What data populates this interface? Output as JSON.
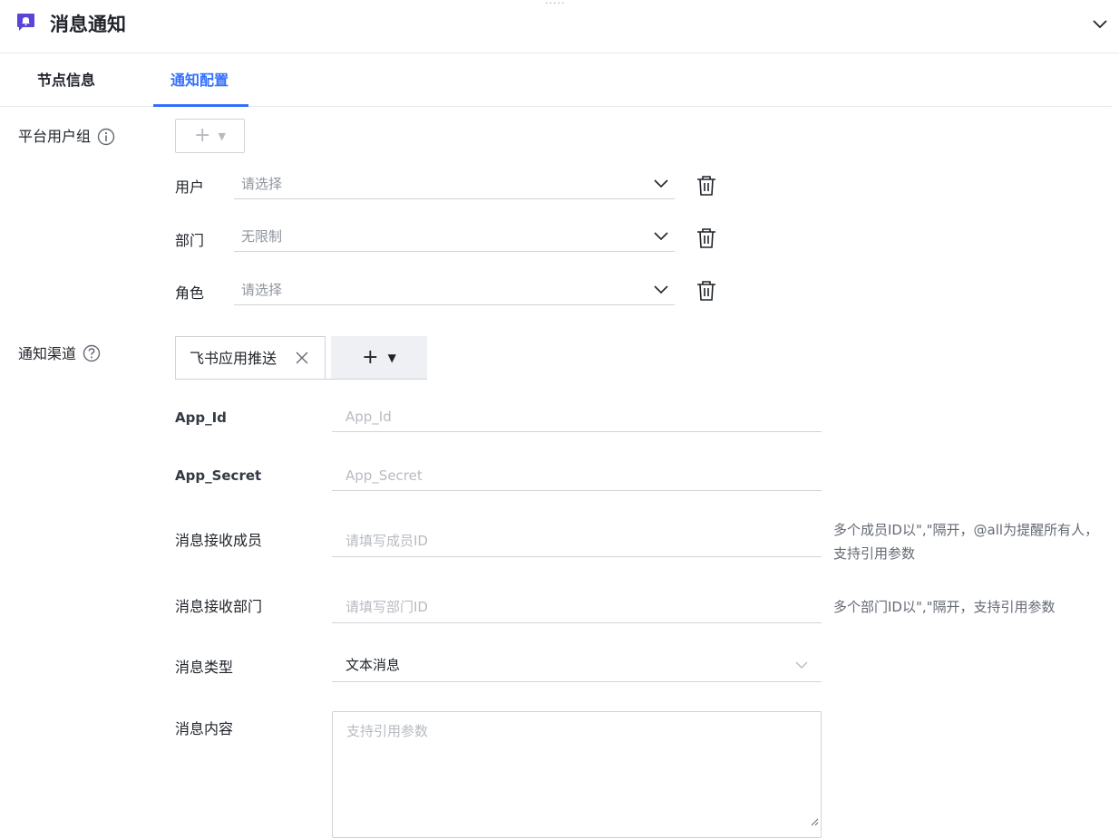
{
  "header": {
    "title": "消息通知",
    "icon": "bell-message-icon",
    "accent": "#5b45d9",
    "drag_handle": "....."
  },
  "tabs": [
    {
      "label": "节点信息",
      "active": false
    },
    {
      "label": "通知配置",
      "active": true
    }
  ],
  "colors": {
    "active_tab": "#3370ff",
    "border": "#d0d3d6",
    "text": "#1f2329",
    "hint": "#646a73",
    "placeholder": "#b7bbc1"
  },
  "platform_group": {
    "label": "平台用户组",
    "rows": [
      {
        "label": "用户",
        "placeholder": "请选择"
      },
      {
        "label": "部门",
        "placeholder": "无限制"
      },
      {
        "label": "角色",
        "placeholder": "请选择"
      }
    ]
  },
  "channel": {
    "label": "通知渠道",
    "active_channel": "飞书应用推送",
    "fields": {
      "app_id": {
        "label": "App_Id",
        "placeholder": "App_Id",
        "value": ""
      },
      "app_secret": {
        "label": "App_Secret",
        "placeholder": "App_Secret",
        "value": ""
      },
      "members": {
        "label": "消息接收成员",
        "placeholder": "请填写成员ID",
        "value": "",
        "hint_line1": "多个成员ID以\",\"隔开，@all为提醒所有人，",
        "hint_line2": "支持引用参数"
      },
      "departments": {
        "label": "消息接收部门",
        "placeholder": "请填写部门ID",
        "value": "",
        "hint": "多个部门ID以\",\"隔开，支持引用参数"
      },
      "message_type": {
        "label": "消息类型",
        "value": "文本消息"
      },
      "content": {
        "label": "消息内容",
        "placeholder": "支持引用参数",
        "value": ""
      }
    }
  }
}
